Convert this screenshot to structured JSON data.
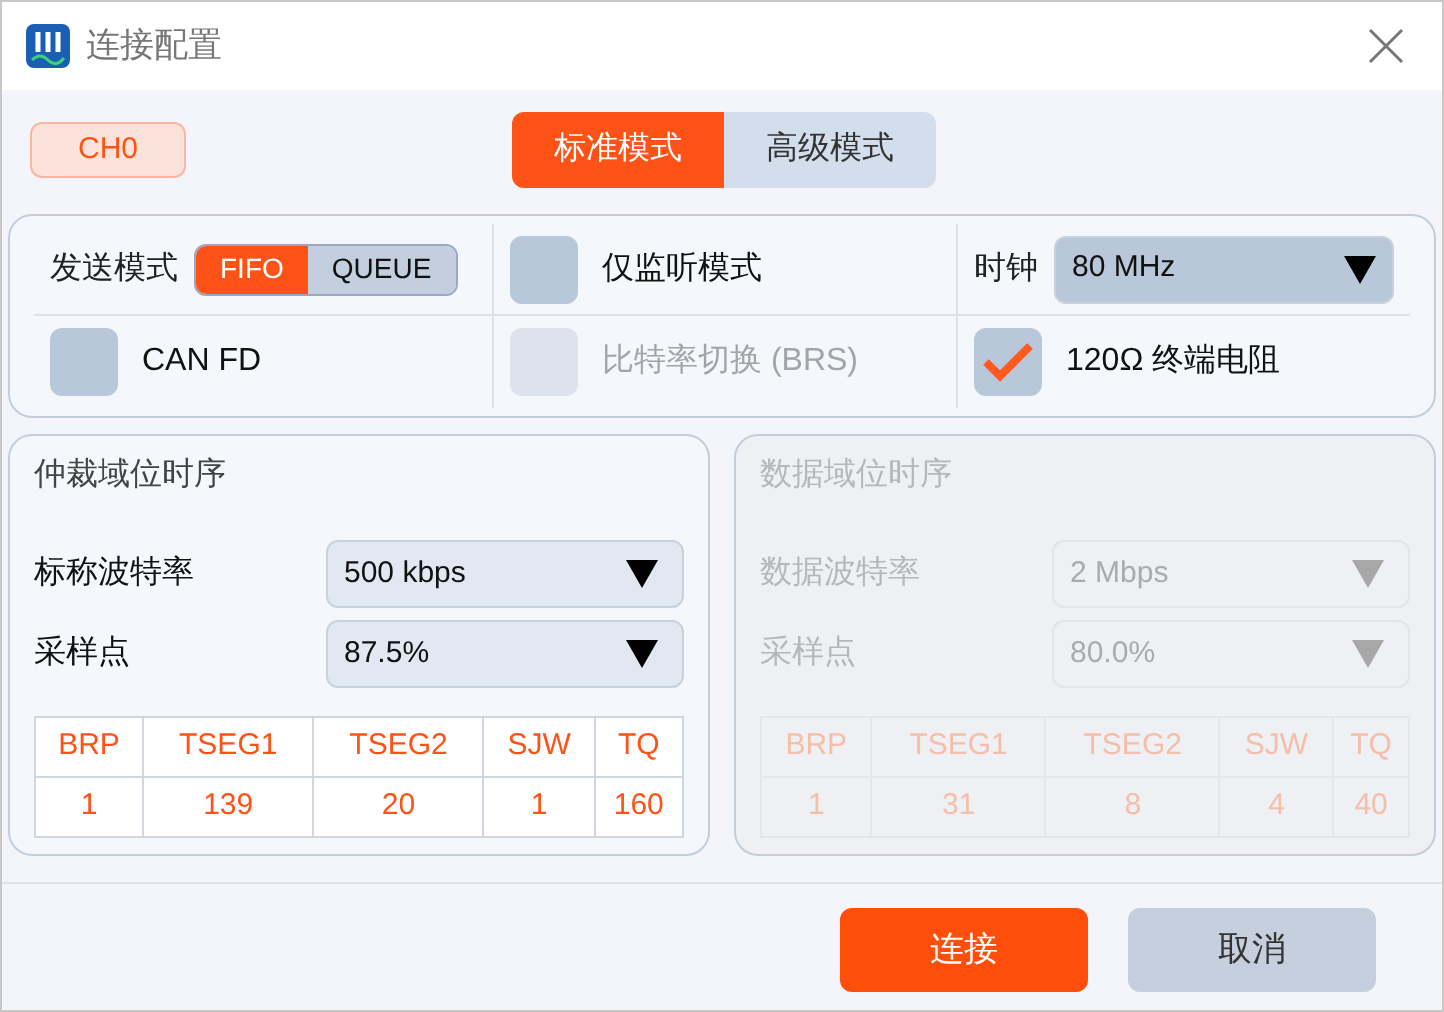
{
  "window": {
    "title": "连接配置"
  },
  "channel": {
    "label": "CH0"
  },
  "mode_tabs": [
    {
      "label": "标准模式",
      "selected": true
    },
    {
      "label": "高级模式",
      "selected": false
    }
  ],
  "settings": [
    {
      "kind": "segmented",
      "label": "发送模式",
      "options": [
        {
          "label": "FIFO",
          "selected": true
        },
        {
          "label": "QUEUE",
          "selected": false
        }
      ]
    },
    {
      "kind": "checkbox",
      "label": "仅监听模式",
      "checked": false,
      "disabled": false
    },
    {
      "kind": "select",
      "label": "时钟",
      "value": "80 MHz"
    },
    {
      "kind": "checkbox",
      "label": "CAN FD",
      "checked": false,
      "disabled": false
    },
    {
      "kind": "checkbox",
      "label": "比特率切换 (BRS)",
      "checked": false,
      "disabled": true
    },
    {
      "kind": "checkbox",
      "label": "120Ω 终端电阻",
      "checked": true,
      "disabled": false
    }
  ],
  "timing_panels": [
    {
      "title": "仲裁域位时序",
      "disabled": false,
      "fields": [
        {
          "label": "标称波特率",
          "value": "500 kbps"
        },
        {
          "label": "采样点",
          "value": "87.5%"
        }
      ],
      "table": {
        "columns": [
          "BRP",
          "TSEG1",
          "TSEG2",
          "SJW",
          "TQ"
        ],
        "values": [
          "1",
          "139",
          "20",
          "1",
          "160"
        ]
      }
    },
    {
      "title": "数据域位时序",
      "disabled": true,
      "fields": [
        {
          "label": "数据波特率",
          "value": "2 Mbps"
        },
        {
          "label": "采样点",
          "value": "80.0%"
        }
      ],
      "table": {
        "columns": [
          "BRP",
          "TSEG1",
          "TSEG2",
          "SJW",
          "TQ"
        ],
        "values": [
          "1",
          "31",
          "8",
          "4",
          "40"
        ]
      }
    }
  ],
  "buttons": [
    {
      "label": "连接",
      "kind": "primary"
    },
    {
      "label": "取消",
      "kind": "secondary"
    }
  ]
}
